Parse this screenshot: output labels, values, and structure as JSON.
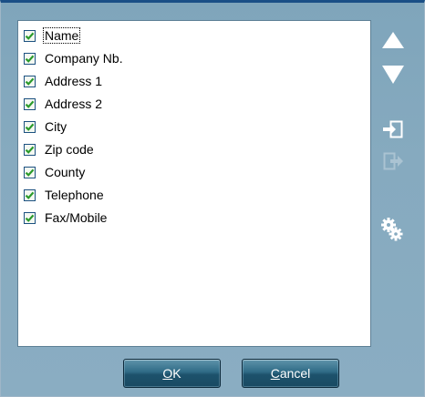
{
  "list": {
    "items": [
      {
        "label": "Name",
        "checked": true
      },
      {
        "label": "Company Nb.",
        "checked": true
      },
      {
        "label": "Address 1",
        "checked": true
      },
      {
        "label": "Address 2",
        "checked": true
      },
      {
        "label": "City",
        "checked": true
      },
      {
        "label": "Zip code",
        "checked": true
      },
      {
        "label": "County",
        "checked": true
      },
      {
        "label": "Telephone",
        "checked": true
      },
      {
        "label": "Fax/Mobile",
        "checked": true
      }
    ]
  },
  "buttons": {
    "ok": {
      "mnemonic": "O",
      "rest": "K"
    },
    "cancel": {
      "mnemonic": "C",
      "rest": "ancel"
    }
  },
  "icons": {
    "move_up": "triangle-up-icon",
    "move_down": "triangle-down-icon",
    "import": "import-icon",
    "export": "export-icon",
    "settings": "gears-icon"
  },
  "colors": {
    "panel": "#86aabf",
    "button": "#2f6b86",
    "check": "#2a9a2a"
  }
}
